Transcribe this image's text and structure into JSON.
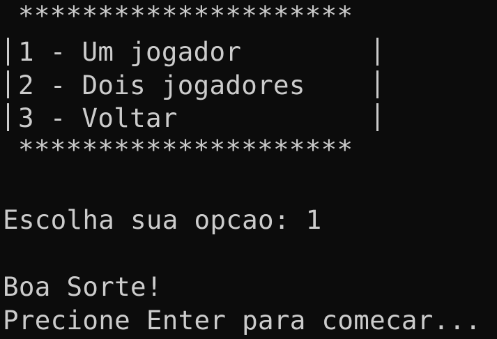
{
  "console": {
    "border_top": "*********************",
    "menu": [
      {
        "label": "1 - Um jogador"
      },
      {
        "label": "2 - Dois jogadores"
      },
      {
        "label": "3 - Voltar"
      }
    ],
    "border_bottom": "*********************",
    "prompt_label": "Escolha sua opcao: ",
    "prompt_input": "1",
    "message": "Boa Sorte!",
    "continue_prompt": "Precione Enter para comecar...",
    "colors": {
      "background": "#0c0c0c",
      "text": "#cccccc"
    }
  }
}
